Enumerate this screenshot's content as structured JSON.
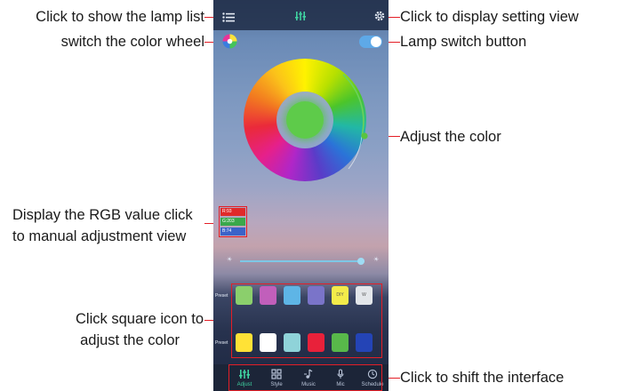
{
  "annotations": {
    "lamp_list": "Click to show the lamp list",
    "color_wheel_switch": "switch the color wheel",
    "setting_view": "Click to  display setting view",
    "lamp_switch": "Lamp switch button",
    "adjust_color": "Adjust the color",
    "rgb_line1": "Display the RGB value click",
    "rgb_line2": "to manual adjustment view",
    "square_line1": "Click square icon to",
    "square_line2": "adjust the color",
    "shift_interface": "Click to shift the interface"
  },
  "app": {
    "topbar_icons": {
      "left": "menu-list-icon",
      "center": "adjust-sliders-icon",
      "right": "gear-icon"
    },
    "power_switch": {
      "state": "on"
    },
    "color_wheel": {
      "selected_color": "#5ecb4a",
      "handle_color": "#59c43f"
    },
    "rgb": {
      "r_label": "R:93",
      "g_label": "G:203",
      "b_label": "B:74",
      "r_color": "#e02a2a",
      "g_color": "#3aa84b",
      "b_color": "#3b63c9"
    },
    "brightness": {
      "value_fraction": 0.97,
      "min_symbol": "☀",
      "max_symbol": "☀"
    },
    "preset_rows": [
      {
        "label": "Preset",
        "swatches": [
          {
            "color": "#8bcf6c",
            "text": ""
          },
          {
            "color": "#c15fbb",
            "text": ""
          },
          {
            "color": "#5eb5e6",
            "text": ""
          },
          {
            "color": "#7a74c9",
            "text": ""
          },
          {
            "color": "#f3eb4a",
            "text": "DIY"
          },
          {
            "color": "#e3e6ea",
            "text": "W"
          }
        ]
      },
      {
        "label": "Preset",
        "swatches": [
          {
            "color": "#ffe236",
            "text": ""
          },
          {
            "color": "#ffffff",
            "text": ""
          },
          {
            "color": "#8fd3d9",
            "text": ""
          },
          {
            "color": "#e8213a",
            "text": ""
          },
          {
            "color": "#58b84a",
            "text": ""
          },
          {
            "color": "#2444b6",
            "text": ""
          }
        ]
      }
    ],
    "tabs": [
      {
        "label": "Adjust",
        "icon": "adjust-sliders-icon",
        "active": true
      },
      {
        "label": "Style",
        "icon": "grid-style-icon",
        "active": false
      },
      {
        "label": "Music",
        "icon": "music-note-icon",
        "active": false
      },
      {
        "label": "Mic",
        "icon": "microphone-icon",
        "active": false
      },
      {
        "label": "Schedule",
        "icon": "clock-icon",
        "active": false
      }
    ],
    "accent_color": "#3fd1a0"
  }
}
